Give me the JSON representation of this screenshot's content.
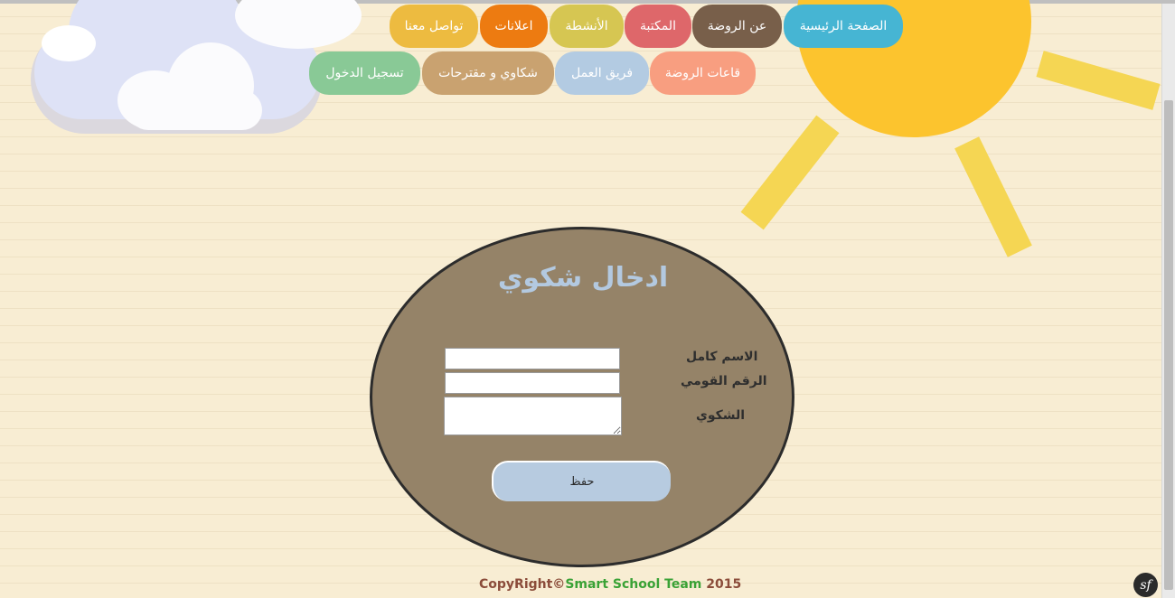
{
  "nav": {
    "row1": [
      {
        "label": "الصفحة الرئيسية",
        "color": "#46b5d3"
      },
      {
        "label": "عن الروضة",
        "color": "#785f4a"
      },
      {
        "label": "المكتبة",
        "color": "#de676a"
      },
      {
        "label": "الأنشطة",
        "color": "#d6c652"
      },
      {
        "label": "اعلانات",
        "color": "#ed7b11"
      },
      {
        "label": "تواصل معنا",
        "color": "#edbb40"
      }
    ],
    "row2": [
      {
        "label": "قاعات الروضة",
        "color": "#f89e80"
      },
      {
        "label": "فريق العمل",
        "color": "#b3cbe2"
      },
      {
        "label": "شكاوي و مقترحات",
        "color": "#c9a270"
      },
      {
        "label": "تسجيل الدخول",
        "color": "#89c996"
      }
    ]
  },
  "form": {
    "title": "ادخال شكوي",
    "fields": [
      {
        "label": "الاسم كامل",
        "value": ""
      },
      {
        "label": "الرقم القومي",
        "value": ""
      },
      {
        "label": "الشكوي",
        "value": ""
      }
    ],
    "submit_label": "حفظ"
  },
  "footer": {
    "prefix": "CopyRight©",
    "brand": "Smart School Team",
    "year": " 2015"
  },
  "debug_badge": "sf",
  "colors": {
    "background": "#f8edd3",
    "sun": "#fcc42e",
    "oval": "#958368",
    "title": "#b3c9e0"
  }
}
